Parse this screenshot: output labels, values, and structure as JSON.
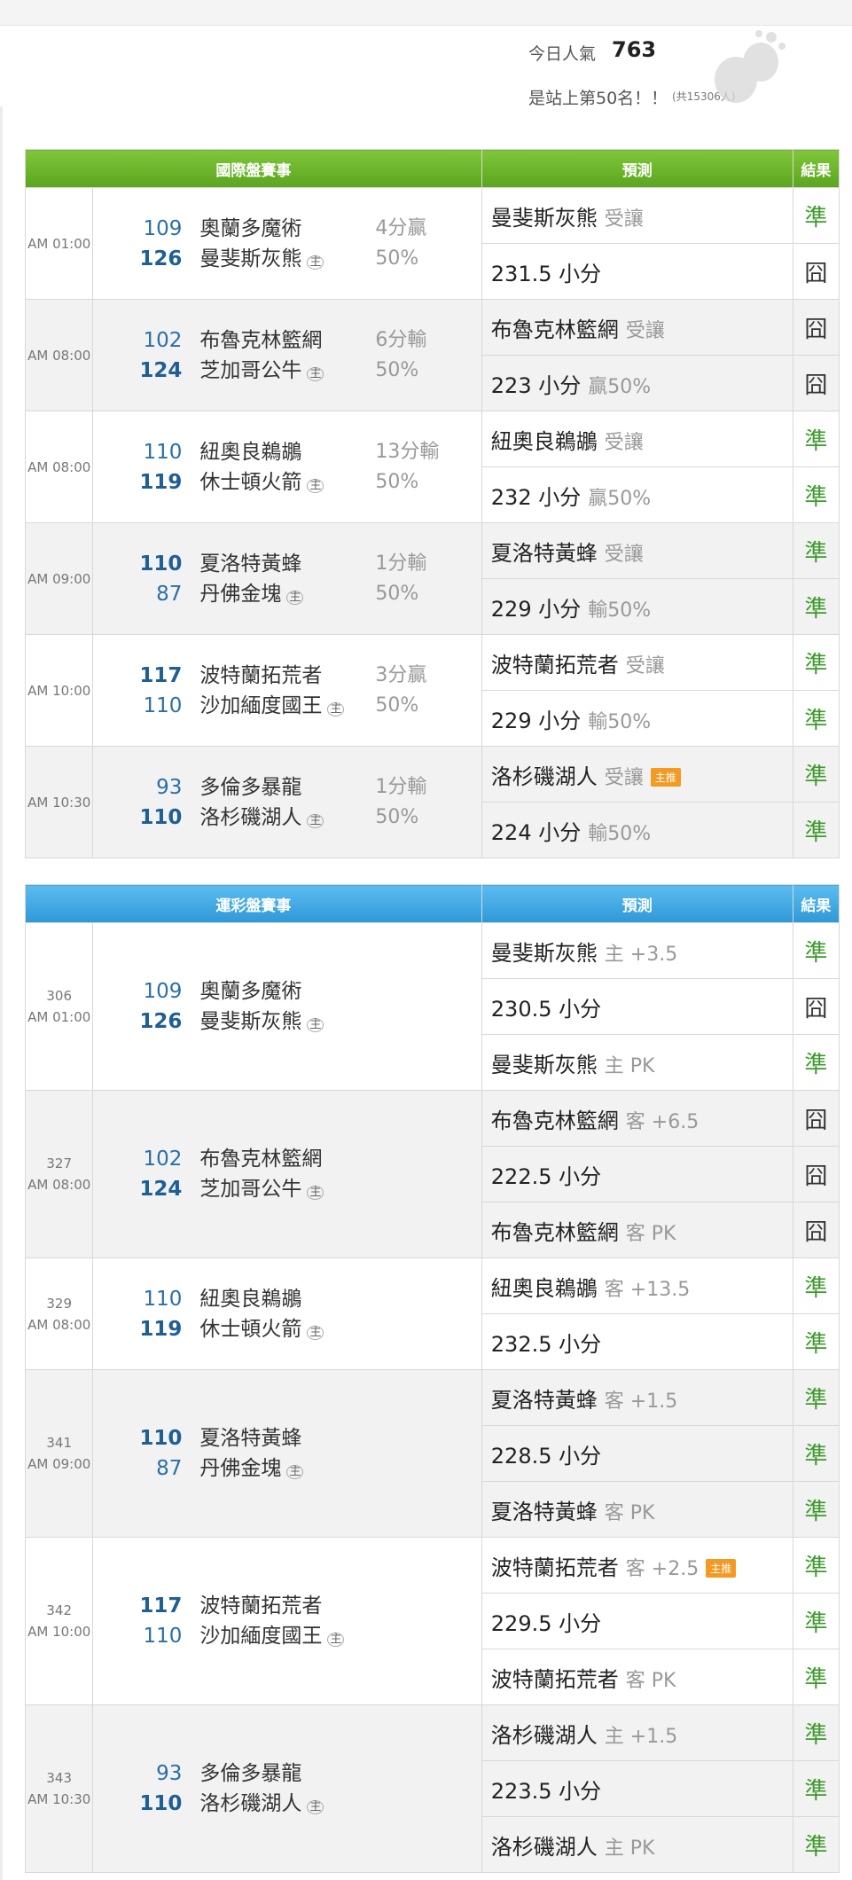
{
  "popularity": {
    "label": "今日人氣",
    "value": "763",
    "rank_text": "是站上第50名！！",
    "rank_total": "(共15306人)"
  },
  "intl": {
    "headers": {
      "event": "國際盤賽事",
      "prediction": "預測",
      "result": "結果"
    },
    "games": [
      {
        "time": "AM 01:00",
        "away_score": "109",
        "away": "奧蘭多魔術",
        "home_score": "126",
        "home": "曼斐斯灰熊",
        "home_tag": "主",
        "hand1": "4分贏",
        "hand2": "50%",
        "winner": "home",
        "pred1_main": "曼斐斯灰熊",
        "pred1_sub": "受讓",
        "res1": "準",
        "pred2_main": "231.5 小分",
        "pred2_sub": "",
        "res2": "囧"
      },
      {
        "time": "AM 08:00",
        "away_score": "102",
        "away": "布魯克林籃網",
        "home_score": "124",
        "home": "芝加哥公牛",
        "home_tag": "主",
        "hand1": "6分輸",
        "hand2": "50%",
        "winner": "home",
        "pred1_main": "布魯克林籃網",
        "pred1_sub": "受讓",
        "res1": "囧",
        "pred2_main": "223 小分",
        "pred2_sub": "贏50%",
        "res2": "囧"
      },
      {
        "time": "AM 08:00",
        "away_score": "110",
        "away": "紐奧良鵜鶘",
        "home_score": "119",
        "home": "休士頓火箭",
        "home_tag": "主",
        "hand1": "13分輸",
        "hand2": "50%",
        "winner": "home",
        "pred1_main": "紐奧良鵜鶘",
        "pred1_sub": "受讓",
        "res1": "準",
        "pred2_main": "232 小分",
        "pred2_sub": "贏50%",
        "res2": "準"
      },
      {
        "time": "AM 09:00",
        "away_score": "110",
        "away": "夏洛特黃蜂",
        "home_score": "87",
        "home": "丹佛金塊",
        "home_tag": "主",
        "hand1": "1分輸",
        "hand2": "50%",
        "winner": "away",
        "pred1_main": "夏洛特黃蜂",
        "pred1_sub": "受讓",
        "res1": "準",
        "pred2_main": "229 小分",
        "pred2_sub": "輸50%",
        "res2": "準"
      },
      {
        "time": "AM 10:00",
        "away_score": "117",
        "away": "波特蘭拓荒者",
        "home_score": "110",
        "home": "沙加緬度國王",
        "home_tag": "主",
        "hand1": "3分贏",
        "hand2": "50%",
        "winner": "away",
        "pred1_main": "波特蘭拓荒者",
        "pred1_sub": "受讓",
        "res1": "準",
        "pred2_main": "229 小分",
        "pred2_sub": "輸50%",
        "res2": "準"
      },
      {
        "time": "AM 10:30",
        "away_score": "93",
        "away": "多倫多暴龍",
        "home_score": "110",
        "home": "洛杉磯湖人",
        "home_tag": "主",
        "hand1": "1分輸",
        "hand2": "50%",
        "winner": "home",
        "pred1_main": "洛杉磯湖人",
        "pred1_sub": "受讓",
        "pred1_badge": "主推",
        "res1": "準",
        "pred2_main": "224 小分",
        "pred2_sub": "輸50%",
        "res2": "準"
      }
    ]
  },
  "sports": {
    "headers": {
      "event": "運彩盤賽事",
      "prediction": "預測",
      "result": "結果"
    },
    "games": [
      {
        "no": "306",
        "time": "AM 01:00",
        "away_score": "109",
        "away": "奧蘭多魔術",
        "home_score": "126",
        "home": "曼斐斯灰熊",
        "home_tag": "主",
        "winner": "home",
        "preds": [
          {
            "main": "曼斐斯灰熊",
            "sub": "主 +3.5",
            "res": "準"
          },
          {
            "main": "230.5 小分",
            "sub": "",
            "res": "囧"
          },
          {
            "main": "曼斐斯灰熊",
            "sub": "主 PK",
            "res": "準"
          }
        ]
      },
      {
        "no": "327",
        "time": "AM 08:00",
        "away_score": "102",
        "away": "布魯克林籃網",
        "home_score": "124",
        "home": "芝加哥公牛",
        "home_tag": "主",
        "winner": "home",
        "preds": [
          {
            "main": "布魯克林籃網",
            "sub": "客 +6.5",
            "res": "囧"
          },
          {
            "main": "222.5 小分",
            "sub": "",
            "res": "囧"
          },
          {
            "main": "布魯克林籃網",
            "sub": "客 PK",
            "res": "囧"
          }
        ]
      },
      {
        "no": "329",
        "time": "AM 08:00",
        "away_score": "110",
        "away": "紐奧良鵜鶘",
        "home_score": "119",
        "home": "休士頓火箭",
        "home_tag": "主",
        "winner": "home",
        "preds": [
          {
            "main": "紐奧良鵜鶘",
            "sub": "客 +13.5",
            "res": "準"
          },
          {
            "main": "232.5 小分",
            "sub": "",
            "res": "準"
          }
        ]
      },
      {
        "no": "341",
        "time": "AM 09:00",
        "away_score": "110",
        "away": "夏洛特黃蜂",
        "home_score": "87",
        "home": "丹佛金塊",
        "home_tag": "主",
        "winner": "away",
        "preds": [
          {
            "main": "夏洛特黃蜂",
            "sub": "客 +1.5",
            "res": "準"
          },
          {
            "main": "228.5 小分",
            "sub": "",
            "res": "準"
          },
          {
            "main": "夏洛特黃蜂",
            "sub": "客 PK",
            "res": "準"
          }
        ]
      },
      {
        "no": "342",
        "time": "AM 10:00",
        "away_score": "117",
        "away": "波特蘭拓荒者",
        "home_score": "110",
        "home": "沙加緬度國王",
        "home_tag": "主",
        "winner": "away",
        "preds": [
          {
            "main": "波特蘭拓荒者",
            "sub": "客 +2.5",
            "badge": "主推",
            "res": "準"
          },
          {
            "main": "229.5 小分",
            "sub": "",
            "res": "準"
          },
          {
            "main": "波特蘭拓荒者",
            "sub": "客 PK",
            "res": "準"
          }
        ]
      },
      {
        "no": "343",
        "time": "AM 10:30",
        "away_score": "93",
        "away": "多倫多暴龍",
        "home_score": "110",
        "home": "洛杉磯湖人",
        "home_tag": "主",
        "winner": "home",
        "preds": [
          {
            "main": "洛杉磯湖人",
            "sub": "主 +1.5",
            "res": "準"
          },
          {
            "main": "223.5 小分",
            "sub": "",
            "res": "準"
          },
          {
            "main": "洛杉磯湖人",
            "sub": "主 PK",
            "res": "準"
          }
        ]
      }
    ]
  }
}
